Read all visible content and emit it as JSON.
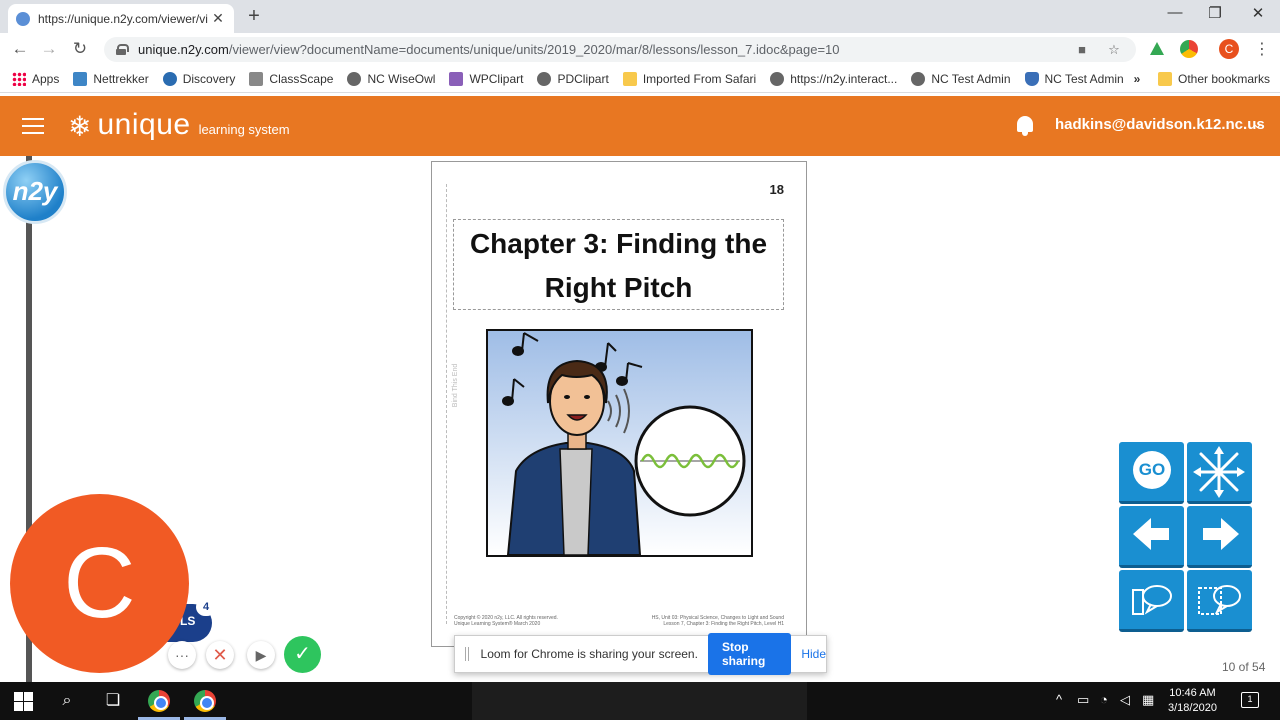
{
  "browser": {
    "tab_title": "https://unique.n2y.com/viewer/vi",
    "url_host": "unique.n2y.com",
    "url_path": "/viewer/view?documentName=documents/unique/units/2019_2020/mar/8/lessons/lesson_7.idoc&page=10",
    "profile_initial": "C",
    "bookmarks": [
      "Apps",
      "Nettrekker",
      "Discovery",
      "ClassScape",
      "NC WiseOwl",
      "WPClipart",
      "PDClipart",
      "Imported From Safari",
      "https://n2y.interact...",
      "NC Test Admin",
      "NC Test Admin"
    ],
    "bookmark_icons": [
      "apps-icon",
      "nettrekker-icon",
      "discovery-icon",
      "classscape-icon",
      "globe-icon",
      "wpclipart-icon",
      "globe-icon",
      "folder-icon",
      "globe-icon",
      "globe-icon",
      "shield-icon"
    ],
    "more_chevron": "»",
    "other_bookmarks": "Other bookmarks"
  },
  "app": {
    "logo_word": "unique",
    "logo_sub": "learning system",
    "user_email": "hadkins@davidson.k12.nc.us",
    "n2y_logo": "n2y",
    "brand_color": "#e87722"
  },
  "document": {
    "page_number": "18",
    "title_line1": "Chapter 3: Finding the",
    "title_line2": "Right Pitch",
    "side_text": "Bind This End",
    "footer_left": "Copyright © 2020 n2y, LLC. All rights reserved. Unique Learning System® March 2020",
    "footer_right": "HS, Unit 03: Physical Science, Changes to Light and Sound Lesson 7, Chapter 3: Finding the Right Pitch, Level H1"
  },
  "controls": {
    "go_label": "GO",
    "page_counter": "10 of 54"
  },
  "loom": {
    "bubble_initial": "C",
    "badge_label": "LS",
    "badge_count": "4",
    "share_message": "Loom for Chrome is sharing your screen.",
    "stop_label": "Stop sharing",
    "hide_label": "Hide"
  },
  "taskbar": {
    "time": "10:46 AM",
    "date": "3/18/2020",
    "notification_count": "1"
  }
}
